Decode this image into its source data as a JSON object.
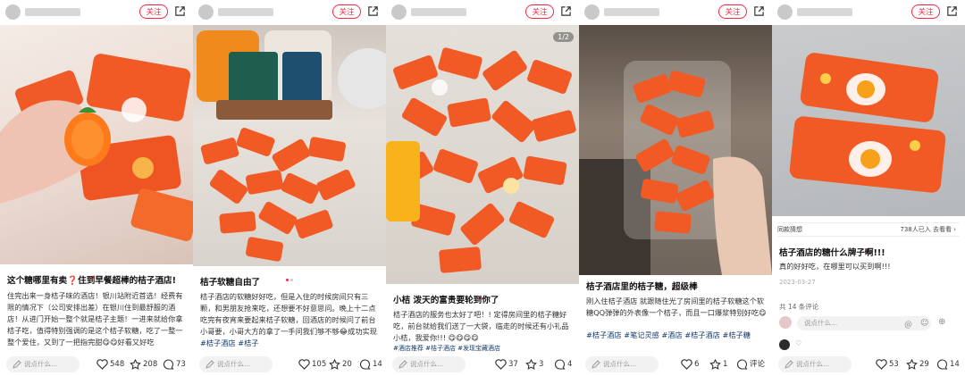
{
  "colors": {
    "accent": "#ff2442",
    "tag": "#13386c"
  },
  "posts": [
    {
      "follow_label": "关注",
      "title": "这个糖哪里有卖❓住到早餐超棒的桔子酒店!",
      "body": "住完出来一身桔子味的酒店！银川站附近首选！经费有限的情况下（公司安排出差）在银川住到最舒服的酒店！从进门开始一整个就是桔子主题！一进来就给你拿桔子吃，值得特别强调的是这个桔子软糖，吃了一整一整个爱住，又到了一把指完甜😋😋好看又好吃",
      "comment_placeholder": "说点什么...",
      "likes": "548",
      "collects": "208",
      "comments": "73"
    },
    {
      "follow_label": "关注",
      "title": "桔子软糖自由了",
      "body": "桔子酒店的软糖好好吃，但是入住的时候房间只有三颗，和男朋友抢来吃，还想要不好意思问。晚上十二点吃完有夜宵来要起来桔子软糖，回酒店的时候问了前台小哥要，小哥大方的拿了一手问我们够不够😂成功实现桔子软糖自由😋😋 ",
      "tags": "#桔子酒店 #桔子",
      "comment_placeholder": "说点什么...",
      "likes": "105",
      "collects": "20",
      "comments": "14"
    },
    {
      "follow_label": "关注",
      "counter": "1/2",
      "title": "小桔 泼天的富贵要轮到你了",
      "body": "桔子酒店的服务也太好了吧！! 定得房间里的桔子糖好吃，前台就给我们送了一大袋，临走的时候还有小礼品小桔，我爱你!!! 😋😋😋😋",
      "tags": "#酒店推荐 #桔子酒店 #发现宝藏酒店",
      "comment_placeholder": "说点什么...",
      "likes": "37",
      "collects": "3",
      "comments": "4"
    },
    {
      "follow_label": "关注",
      "title": "桔子酒店里的桔子糖，超级棒",
      "body": "刚入住桔子酒店 就跟随住光了房间里的桔子软糖这个软糖QQ弹弹的外表像一个桔子，而且一口爆浆特别好吃😋",
      "tags": "#桔子酒店 #笔记灵感 #酒店 #桔子酒店 #桔子糖",
      "comment_placeholder": "说点什么...",
      "likes": "6",
      "collects": "1",
      "comments": "评论"
    },
    {
      "follow_label": "关注",
      "link_label": "同款猜想",
      "link_meta": "738人已入 去看看 ›",
      "title": "桔子酒店的糖什么牌子啊!!!",
      "body": "真的好好吃，在哪里可以买到啊!!!",
      "date": "2023-03-27",
      "comment_count": "共 14 条评论",
      "reply_placeholder": "说点什么...",
      "comment_placeholder": "说点什么...",
      "likes": "53",
      "collects": "29",
      "comments": "14"
    }
  ]
}
